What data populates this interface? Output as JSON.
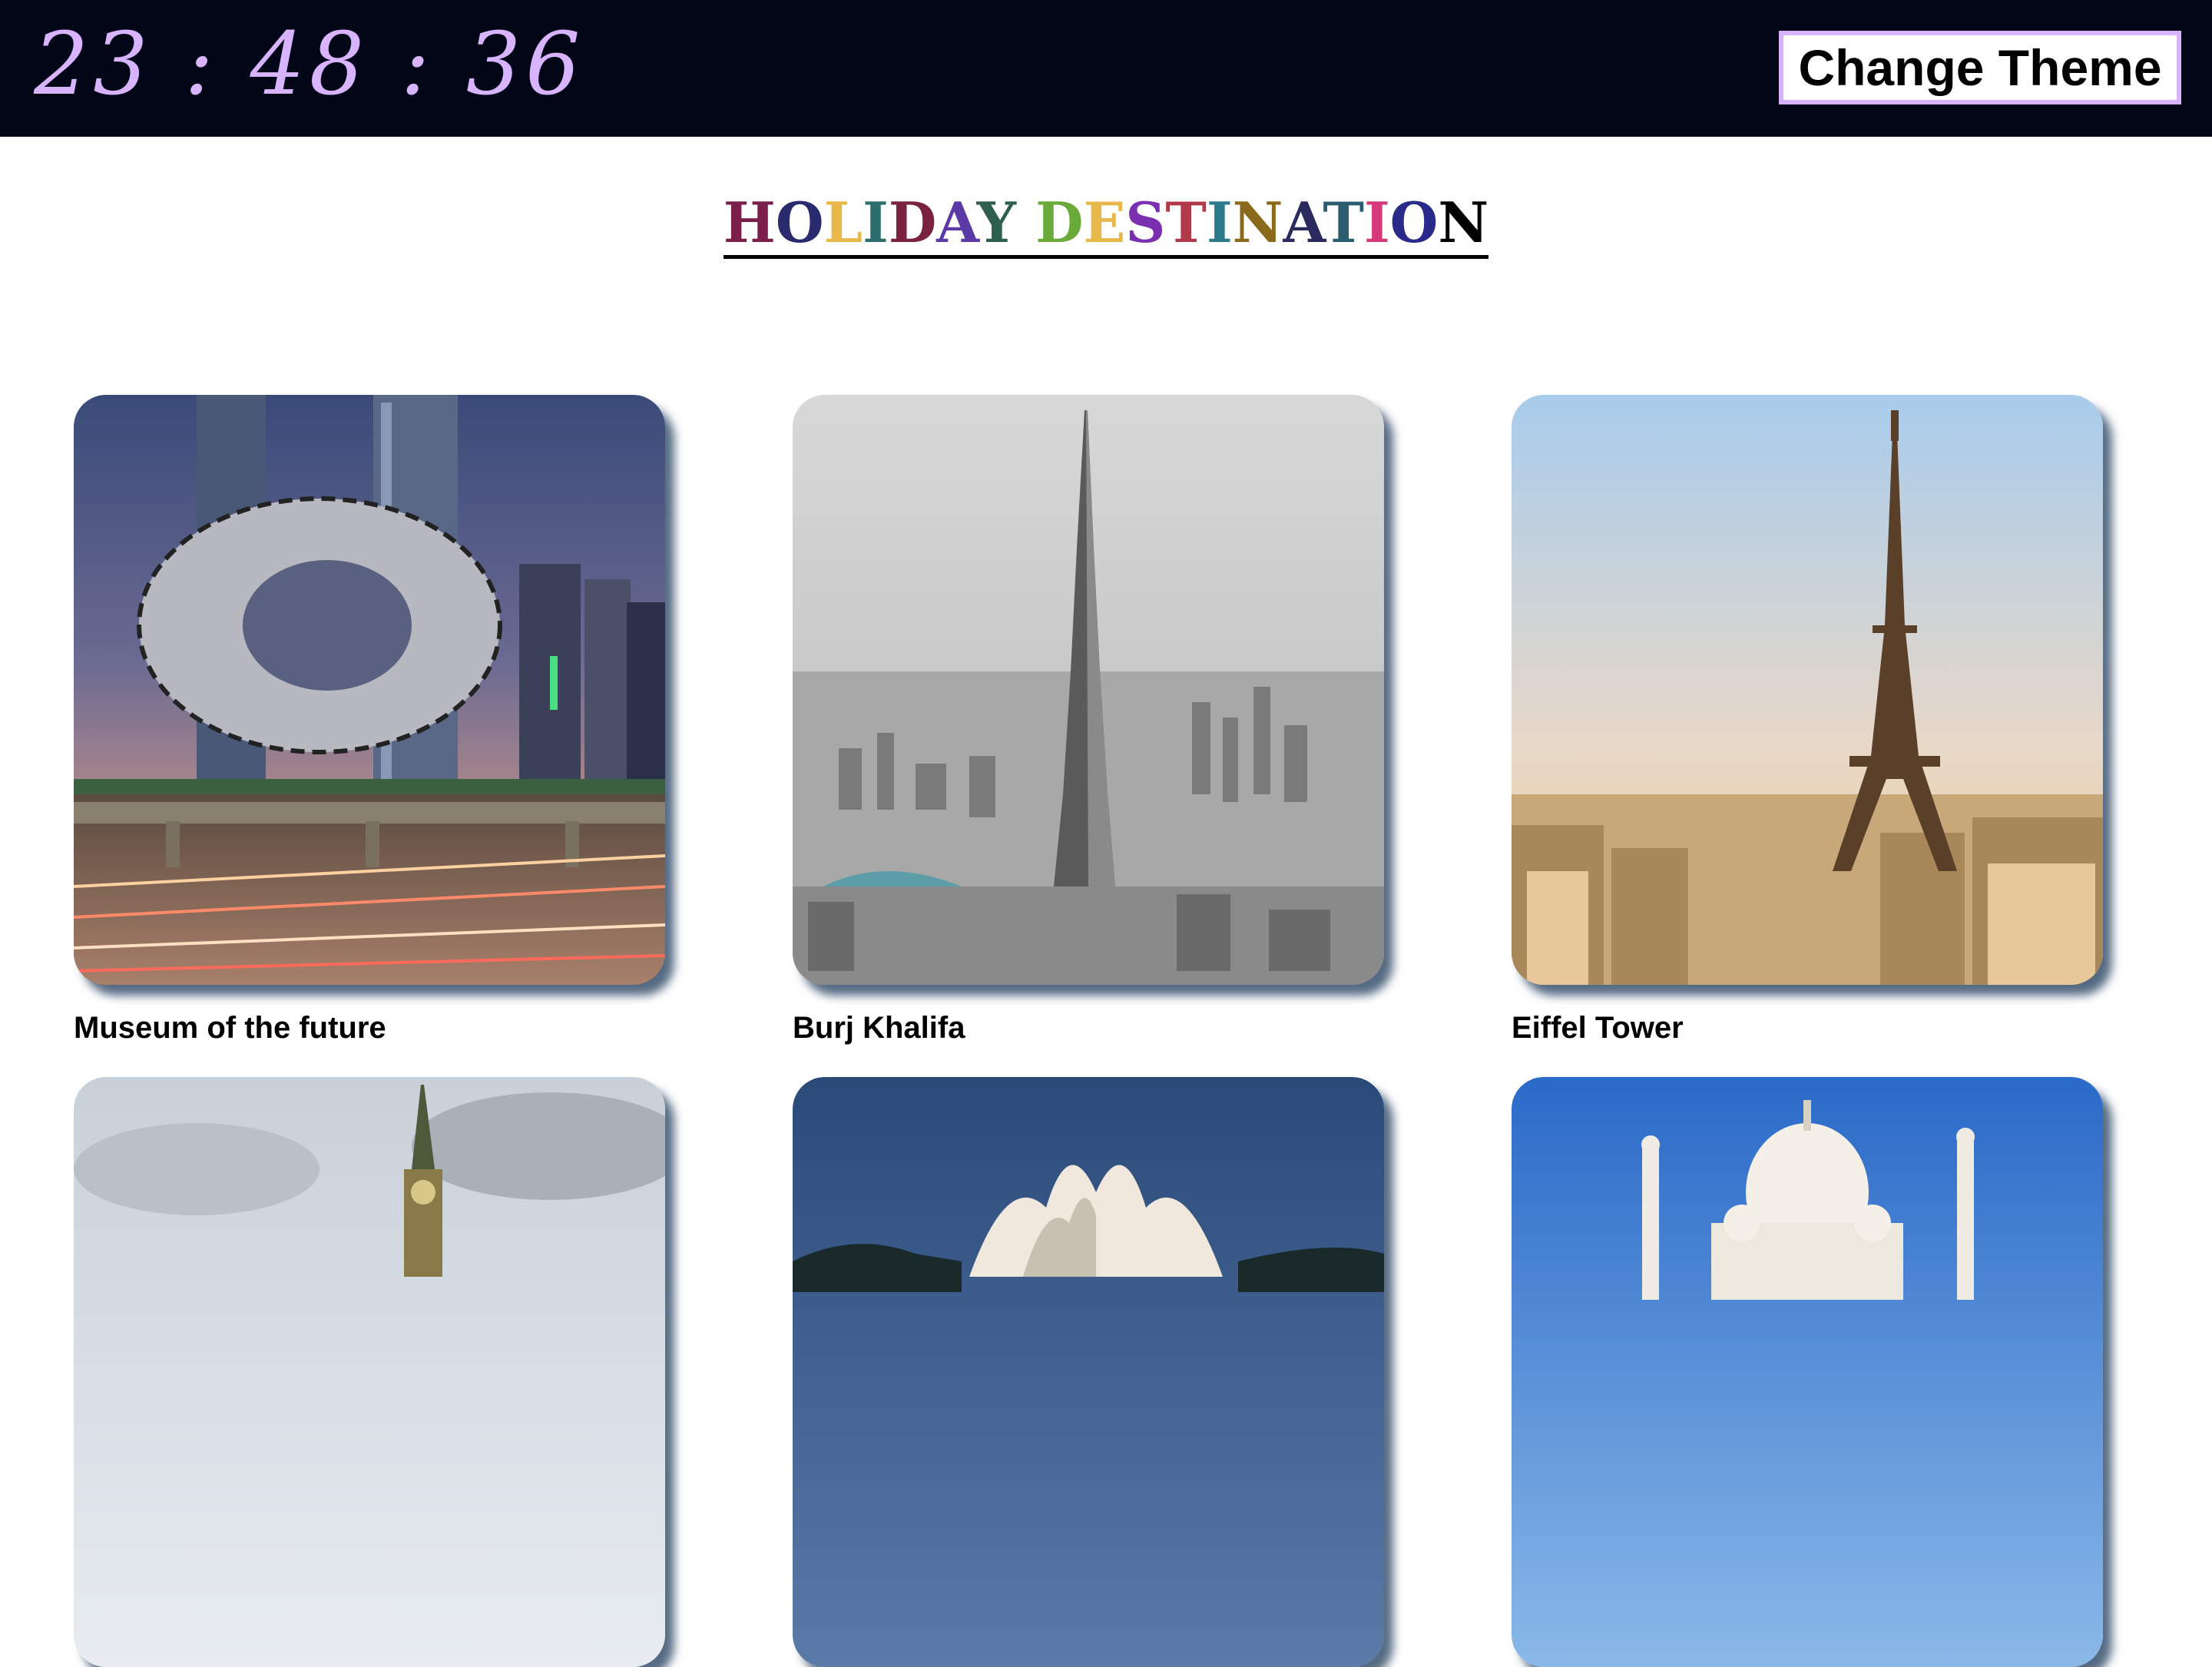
{
  "header": {
    "clock": "23 : 48 : 36",
    "theme_button_label": "Change Theme"
  },
  "heading": {
    "letters": [
      {
        "ch": "H",
        "color": "#7a1f4a"
      },
      {
        "ch": "O",
        "color": "#2a2a6e"
      },
      {
        "ch": "L",
        "color": "#e8b84a"
      },
      {
        "ch": "I",
        "color": "#2c6e6e"
      },
      {
        "ch": "D",
        "color": "#7a2240"
      },
      {
        "ch": "A",
        "color": "#5b3aa8"
      },
      {
        "ch": "Y",
        "color": "#2e5e4e"
      },
      {
        "ch": " ",
        "color": "#000000"
      },
      {
        "ch": "D",
        "color": "#6aaa3a"
      },
      {
        "ch": "E",
        "color": "#e8b84a"
      },
      {
        "ch": "S",
        "color": "#7a2fb0"
      },
      {
        "ch": "T",
        "color": "#b03a4a"
      },
      {
        "ch": "I",
        "color": "#2a7a8a"
      },
      {
        "ch": "N",
        "color": "#8a6a1a"
      },
      {
        "ch": "A",
        "color": "#2a2a5e"
      },
      {
        "ch": "T",
        "color": "#2a5e6e"
      },
      {
        "ch": "I",
        "color": "#d63a7a"
      },
      {
        "ch": "O",
        "color": "#2a2a8a"
      },
      {
        "ch": "N",
        "color": "#000000"
      }
    ]
  },
  "destinations": [
    {
      "name": "Museum of the future",
      "icon": "museum-of-the-future-photo"
    },
    {
      "name": "Burj Khalifa",
      "icon": "burj-khalifa-photo"
    },
    {
      "name": "Eiffel Tower",
      "icon": "eiffel-tower-photo"
    },
    {
      "name": "",
      "icon": "big-ben-photo"
    },
    {
      "name": "",
      "icon": "lotus-temple-photo"
    },
    {
      "name": "",
      "icon": "taj-mahal-photo"
    }
  ],
  "colors": {
    "topbar": "#020617",
    "accent": "#d8b4fe"
  }
}
